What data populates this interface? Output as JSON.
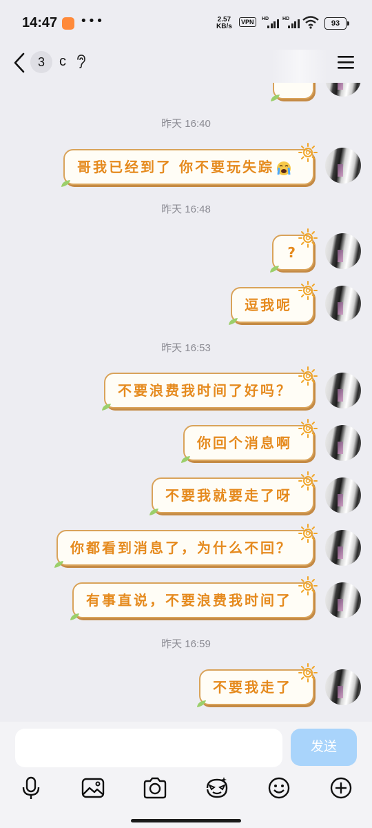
{
  "status_bar": {
    "time": "14:47",
    "speed_value": "2.57",
    "speed_unit": "KB/s",
    "vpn": "VPN",
    "hd1": "HD",
    "hd2": "HD",
    "battery": "93"
  },
  "header": {
    "unread_count": "3",
    "chat_name": "c"
  },
  "messages": {
    "m1": {
      "text": "哥我已经到了 你不要玩失踪"
    },
    "m2": {
      "text": "?"
    },
    "m3": {
      "text": "逗我呢"
    },
    "m4": {
      "text": "不要浪费我时间了好吗？"
    },
    "m5": {
      "text": "你回个消息啊"
    },
    "m6": {
      "text": "不要我就要走了呀"
    },
    "m7": {
      "text": "你都看到消息了，为什么不回？"
    },
    "m8": {
      "text": "有事直说，不要浪费我时间了"
    },
    "m9": {
      "text": "不要我走了"
    }
  },
  "timestamps": {
    "t1": "昨天 16:40",
    "t2": "昨天 16:48",
    "t3": "昨天 16:53",
    "t4": "昨天 16:59"
  },
  "input_bar": {
    "value": "",
    "send_label": "发送"
  },
  "theme": {
    "bubble_text": "#e58a1e",
    "bubble_border": "#d9a35a",
    "send_button": "#a9d4fb"
  },
  "toolbar_icons": [
    "microphone-icon",
    "image-icon",
    "camera-icon",
    "sticker-icon",
    "emoji-icon",
    "plus-icon"
  ]
}
